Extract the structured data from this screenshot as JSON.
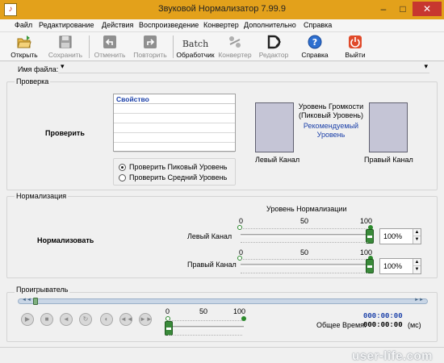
{
  "window": {
    "title": "Звуковой Нормализатор 7.99.9",
    "controls": [
      "–",
      "□",
      "✕"
    ]
  },
  "menu": [
    "Файл",
    "Редактирование",
    "Действия",
    "Воспроизведение",
    "Конвертер",
    "Дополнительно",
    "Справка"
  ],
  "toolbar": {
    "open": "Открыть",
    "save": "Сохранить",
    "undo": "Отменить",
    "redo": "Повторить",
    "batch_icon_text": "Batch",
    "batch": "Обработчик",
    "converter": "Конвертер",
    "editor": "Редактор",
    "help": "Справка",
    "exit": "Выйти"
  },
  "file": {
    "label": "Имя файла:",
    "value": ""
  },
  "check": {
    "group_title": "Проверка",
    "button": "Проверить",
    "table_header": "Свойство",
    "rows": [
      "",
      "",
      "",
      "",
      ""
    ],
    "options": [
      "Проверить Пиковый Уровень",
      "Проверить Средний Уровень"
    ],
    "selected_option": 0,
    "loudness_title": "Уровень Громкости (Пиковый Уровень)",
    "recommended": "Рекомендуемый Уровень",
    "left_channel": "Левый Канал",
    "right_channel": "Правый Канал"
  },
  "normalization": {
    "group_title": "Нормализация",
    "button": "Нормализовать",
    "title": "Уровень Нормализации",
    "scale": [
      "0",
      "50",
      "100"
    ],
    "left": {
      "label": "Левый Канал",
      "value": "100%",
      "level": 1.0
    },
    "right": {
      "label": "Правый Канал",
      "value": "100%",
      "level": 1.0
    }
  },
  "player": {
    "group_title": "Проигрыватель",
    "seek_markers": [
      "◄◄",
      "►►"
    ],
    "volume_scale": [
      "0",
      "50",
      "100"
    ],
    "volume_level": 0.0,
    "current_time": "000:00:00",
    "total_label": "Общее Время:",
    "total_time": "000:00:00",
    "unit": "(мс)",
    "buttons": [
      "▶",
      "■",
      "◄",
      "↻",
      "◐",
      "◄◄",
      "►►"
    ]
  },
  "watermark": "user-life.com",
  "colors": {
    "titlebar": "#e3a11b",
    "accent_blue": "#1a3fa8",
    "slider_green": "#2c8a2c",
    "close": "#c7372f"
  }
}
